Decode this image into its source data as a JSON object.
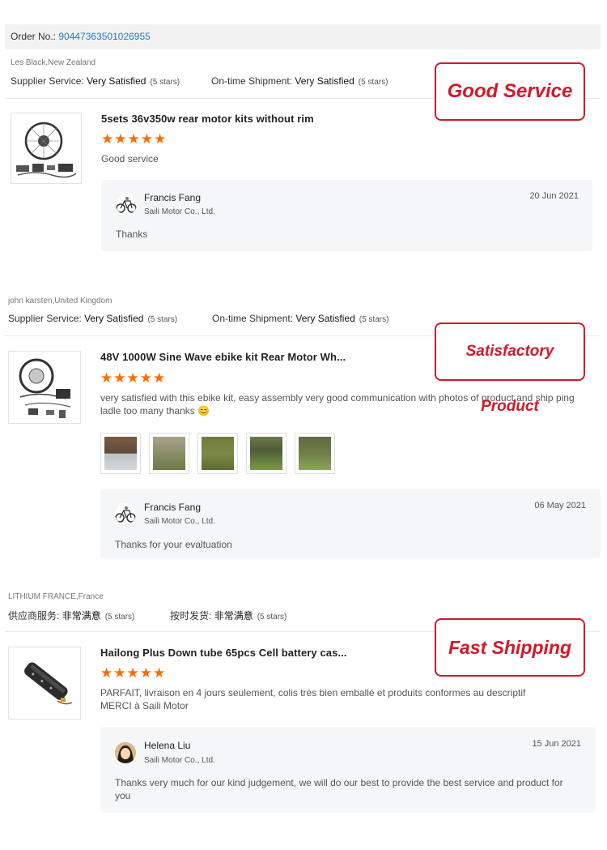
{
  "order": {
    "label": "Order No.: ",
    "number": "90447363501026955"
  },
  "reviews": [
    {
      "buyer": "Les Black,New Zealand",
      "supplier_label": "Supplier Service:",
      "supplier_value": "Very Satisfied",
      "supplier_stars": "(5 stars)",
      "shipment_label": "On-time Shipment:",
      "shipment_value": "Very Satisfied",
      "shipment_stars": "(5 stars)",
      "product_title": "5sets 36v350w rear motor kits without rim",
      "rating": 5,
      "comment": "Good service",
      "reply": {
        "name": "Francis Fang",
        "company": "Saili Motor Co., Ltd.",
        "date": "20 Jun 2021",
        "text": "Thanks"
      },
      "badge": "Good Service"
    },
    {
      "buyer": "john karsten,United Kingdom",
      "supplier_label": "Supplier Service:",
      "supplier_value": "Very Satisfied",
      "supplier_stars": "(5 stars)",
      "shipment_label": "On-time Shipment:",
      "shipment_value": "Very Satisfied",
      "shipment_stars": "(5 stars)",
      "product_title": "48V 1000W Sine Wave ebike kit Rear Motor Wh...",
      "rating": 5,
      "comment": "very satisfied with this ebike kit, easy assembly  very good communication with photos of product and ship ping ladle too many thanks 😊",
      "reply": {
        "name": "Francis Fang",
        "company": "Saili Motor Co., Ltd.",
        "date": "06 May 2021",
        "text": "Thanks for your evaltuation"
      },
      "badge": "Satisfactory Product"
    },
    {
      "buyer": "LITHIUM FRANCE,France",
      "supplier_label": "供应商服务:",
      "supplier_value": "非常满意",
      "supplier_stars": "(5 stars)",
      "shipment_label": "按时发货:",
      "shipment_value": "非常满意",
      "shipment_stars": "(5 stars)",
      "product_title": "Hailong Plus Down tube 65pcs Cell battery cas...",
      "rating": 5,
      "comment": "PARFAIT, livraison en 4 jours seulement, colis très bien emballé et produits conformes au descriptif MERCI à Saili Motor",
      "reply": {
        "name": "Helena Liu",
        "company": "Saili Motor Co., Ltd.",
        "date": "15 Jun 2021",
        "text": "Thanks very much for our kind judgement, we will do our best to provide the best service and product for you"
      },
      "badge": "Fast Shipping"
    }
  ],
  "stars_glyph": "★★★★★",
  "colors": {
    "accent_link": "#2a7ac5",
    "star": "#ff6a00",
    "badge": "#d3182a"
  }
}
